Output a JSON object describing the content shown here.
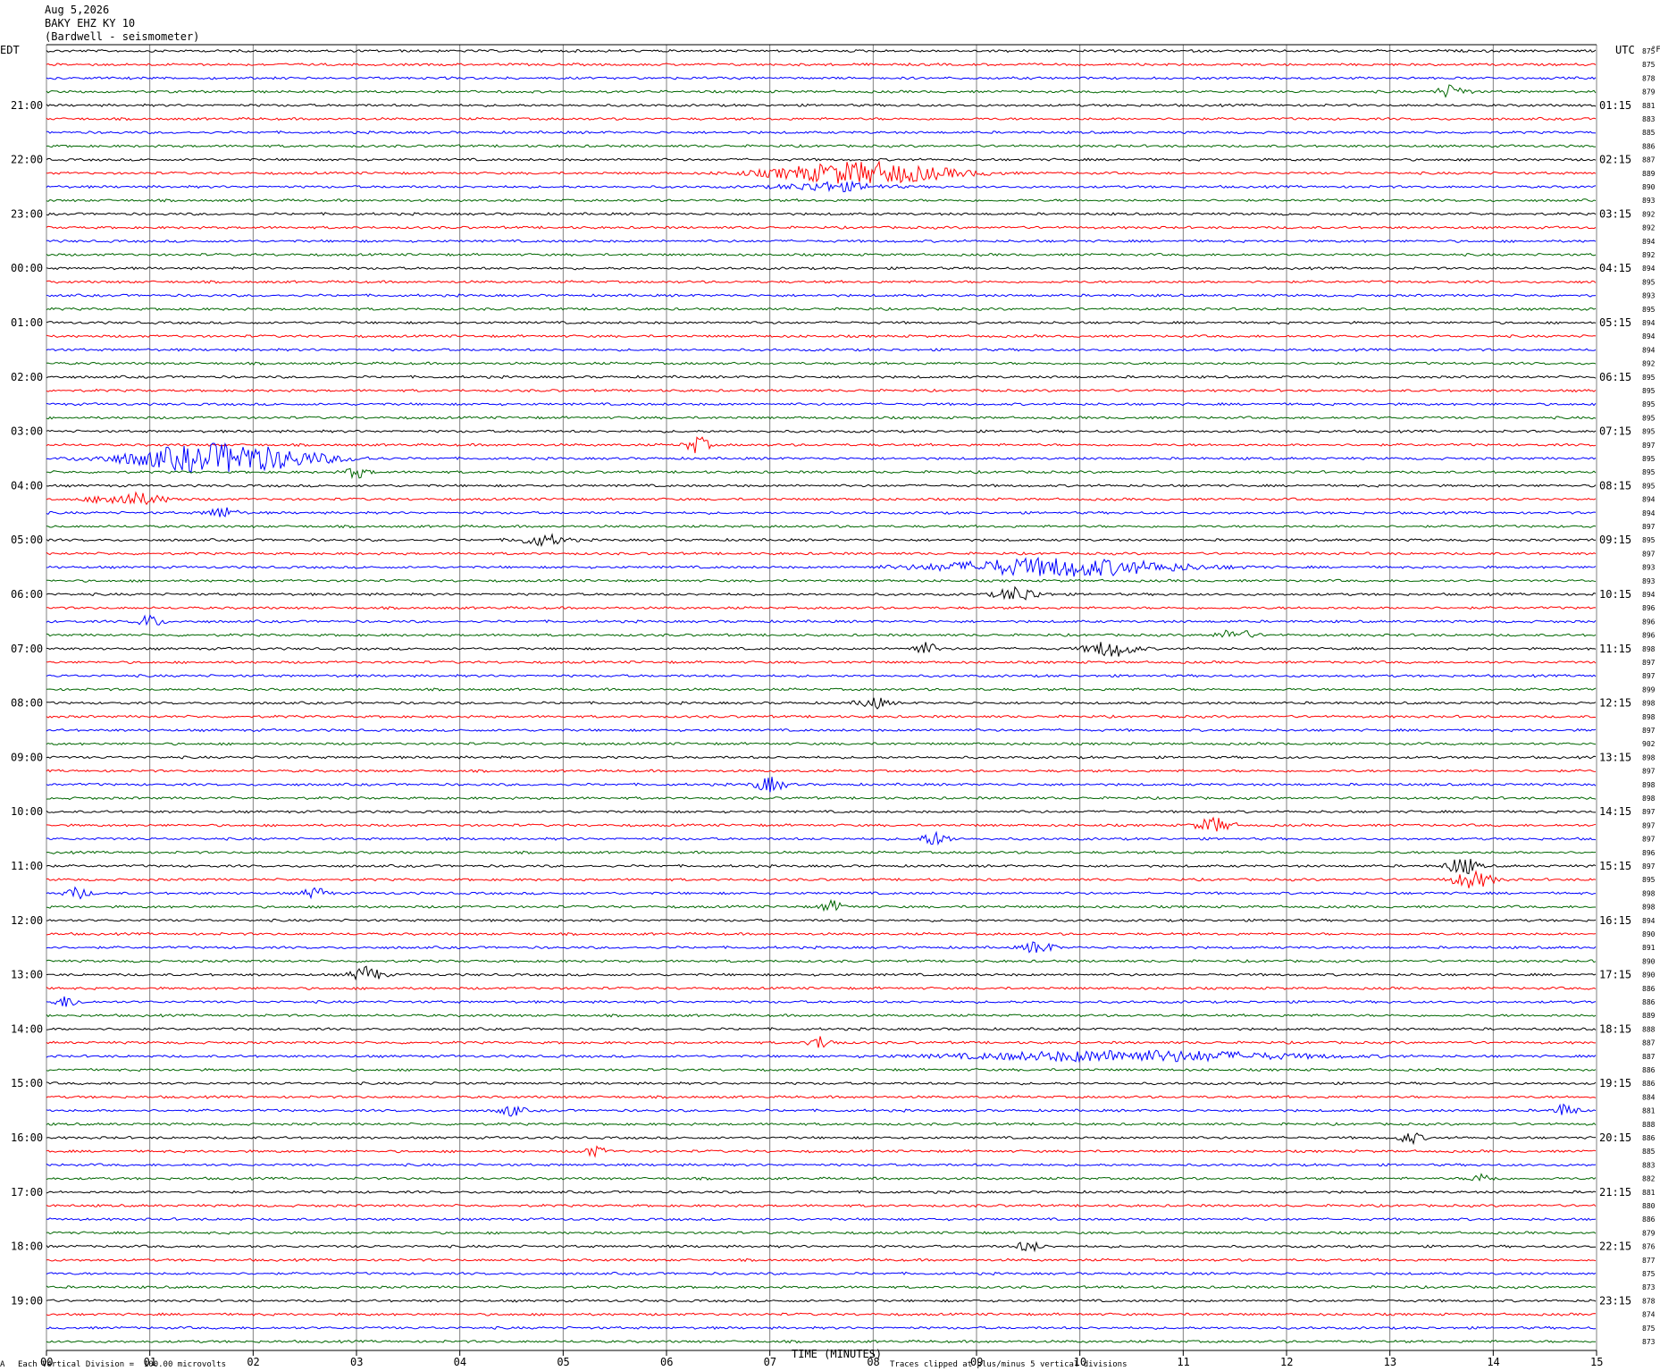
{
  "header": {
    "date": "Aug 5,2026",
    "station": "BAKY EHZ KY 10",
    "location": "(Bardwell - seismometer)"
  },
  "labels": {
    "left_tz": "EDT",
    "right_tz": "UTC",
    "degf": "°F",
    "xlabel": "TIME (MINUTES)",
    "footer_left": "Each Vertical Division =  100.00 microvolts",
    "footer_right": "Traces clipped at plus/minus 5 vertical divisions",
    "corner": "A"
  },
  "colors": {
    "trace_cycle": [
      "#000000",
      "#ff0000",
      "#0000ff",
      "#006600"
    ],
    "gridline": "#808080"
  },
  "chart_data": {
    "type": "seismogram",
    "x_ticks": [
      "00",
      "01",
      "02",
      "03",
      "04",
      "05",
      "06",
      "07",
      "08",
      "09",
      "10",
      "11",
      "12",
      "13",
      "14",
      "15"
    ],
    "xlim": [
      0,
      15
    ],
    "rows_per_hour": 4,
    "left_hour_labels": [
      "21:00",
      "22:00",
      "23:00",
      "00:00",
      "01:00",
      "02:00",
      "03:00",
      "04:00",
      "05:00",
      "06:00",
      "07:00",
      "08:00",
      "09:00",
      "10:00",
      "11:00",
      "12:00",
      "13:00",
      "14:00",
      "15:00",
      "16:00",
      "17:00",
      "18:00",
      "19:00"
    ],
    "right_hour_labels": [
      "01:15",
      "02:15",
      "03:15",
      "04:15",
      "05:15",
      "06:15",
      "07:15",
      "08:15",
      "09:15",
      "10:15",
      "11:15",
      "12:15",
      "13:15",
      "14:15",
      "15:15",
      "16:15",
      "17:15",
      "18:15",
      "19:15",
      "20:15",
      "21:15",
      "22:15",
      "23:15"
    ],
    "temperatures": [
      "875",
      "875",
      "878",
      "879",
      "881",
      "883",
      "885",
      "886",
      "887",
      "889",
      "890",
      "893",
      "892",
      "892",
      "894",
      "892",
      "894",
      "895",
      "893",
      "895",
      "894",
      "894",
      "894",
      "892",
      "895",
      "895",
      "895",
      "895",
      "895",
      "897",
      "895",
      "895",
      "895",
      "894",
      "894",
      "897",
      "895",
      "897",
      "893",
      "893",
      "894",
      "896",
      "896",
      "896",
      "898",
      "897",
      "897",
      "899",
      "898",
      "898",
      "897",
      "902",
      "898",
      "897",
      "898",
      "898",
      "897",
      "897",
      "897",
      "896",
      "897",
      "895",
      "898",
      "898",
      "894",
      "890",
      "891",
      "890",
      "890",
      "886",
      "886",
      "889",
      "888",
      "887",
      "887",
      "886",
      "886",
      "884",
      "881",
      "888",
      "886",
      "885",
      "883",
      "882",
      "881",
      "880",
      "886",
      "879",
      "876",
      "877",
      "875",
      "873",
      "878",
      "874",
      "875",
      "873"
    ],
    "events": [
      {
        "row": 3,
        "minute": 13.6,
        "amp": 7,
        "len": 0.5
      },
      {
        "row": 9,
        "minute": 7.9,
        "amp": 12,
        "len": 3.0
      },
      {
        "row": 10,
        "minute": 7.6,
        "amp": 5,
        "len": 1.6
      },
      {
        "row": 30,
        "minute": 1.7,
        "amp": 16,
        "len": 3.2
      },
      {
        "row": 31,
        "minute": 3.0,
        "amp": 6,
        "len": 0.4
      },
      {
        "row": 29,
        "minute": 6.3,
        "amp": 9,
        "len": 0.4
      },
      {
        "row": 33,
        "minute": 0.8,
        "amp": 7,
        "len": 1.2
      },
      {
        "row": 34,
        "minute": 1.7,
        "amp": 6,
        "len": 0.5
      },
      {
        "row": 36,
        "minute": 4.8,
        "amp": 6,
        "len": 0.8
      },
      {
        "row": 38,
        "minute": 9.8,
        "amp": 10,
        "len": 4.0
      },
      {
        "row": 40,
        "minute": 9.4,
        "amp": 8,
        "len": 0.7
      },
      {
        "row": 42,
        "minute": 1.0,
        "amp": 7,
        "len": 0.4
      },
      {
        "row": 43,
        "minute": 11.5,
        "amp": 6,
        "len": 0.6
      },
      {
        "row": 44,
        "minute": 10.3,
        "amp": 9,
        "len": 0.8
      },
      {
        "row": 44,
        "minute": 8.5,
        "amp": 7,
        "len": 0.4
      },
      {
        "row": 48,
        "minute": 8.0,
        "amp": 6,
        "len": 0.5
      },
      {
        "row": 54,
        "minute": 7.0,
        "amp": 8,
        "len": 0.5
      },
      {
        "row": 57,
        "minute": 11.3,
        "amp": 8,
        "len": 0.6
      },
      {
        "row": 58,
        "minute": 8.6,
        "amp": 7,
        "len": 0.5
      },
      {
        "row": 60,
        "minute": 13.7,
        "amp": 10,
        "len": 0.5
      },
      {
        "row": 61,
        "minute": 13.8,
        "amp": 9,
        "len": 0.7
      },
      {
        "row": 62,
        "minute": 0.3,
        "amp": 6,
        "len": 0.4
      },
      {
        "row": 62,
        "minute": 2.6,
        "amp": 6,
        "len": 0.4
      },
      {
        "row": 63,
        "minute": 7.6,
        "amp": 6,
        "len": 0.4
      },
      {
        "row": 66,
        "minute": 9.6,
        "amp": 7,
        "len": 0.5
      },
      {
        "row": 68,
        "minute": 3.1,
        "amp": 9,
        "len": 0.5
      },
      {
        "row": 70,
        "minute": 0.2,
        "amp": 6,
        "len": 0.4
      },
      {
        "row": 73,
        "minute": 7.5,
        "amp": 7,
        "len": 0.4
      },
      {
        "row": 74,
        "minute": 10.5,
        "amp": 6,
        "len": 5.5
      },
      {
        "row": 78,
        "minute": 4.5,
        "amp": 6,
        "len": 0.4
      },
      {
        "row": 78,
        "minute": 14.7,
        "amp": 7,
        "len": 0.4
      },
      {
        "row": 80,
        "minute": 13.2,
        "amp": 6,
        "len": 0.4
      },
      {
        "row": 81,
        "minute": 5.3,
        "amp": 5,
        "len": 0.4
      },
      {
        "row": 88,
        "minute": 9.5,
        "amp": 6,
        "len": 0.4
      },
      {
        "row": 83,
        "minute": 13.9,
        "amp": 5,
        "len": 0.4
      }
    ]
  }
}
